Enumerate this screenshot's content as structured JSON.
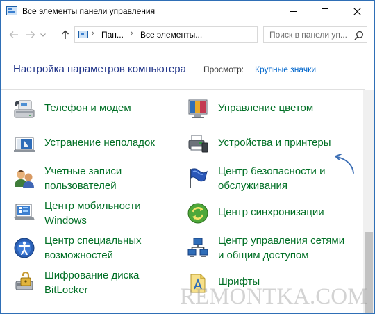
{
  "window": {
    "title": "Все элементы панели управления"
  },
  "addressbar": {
    "crumb_1": "Пан...",
    "crumb_2": "Все элементы...",
    "search_placeholder": "Поиск в панели уп..."
  },
  "header": {
    "title": "Настройка параметров компьютера",
    "view_label": "Просмотр:",
    "view_value": "Крупные значки"
  },
  "items": {
    "left": [
      {
        "line1": "Телефон и модем",
        "line2": "",
        "icon": "phone-modem-icon"
      },
      {
        "line1": "Устранение неполадок",
        "line2": "",
        "icon": "troubleshooting-icon"
      },
      {
        "line1": "Учетные записи",
        "line2": "пользователей",
        "icon": "user-accounts-icon"
      },
      {
        "line1": "Центр мобильности",
        "line2": "Windows",
        "icon": "mobility-center-icon"
      },
      {
        "line1": "Центр специальных",
        "line2": "возможностей",
        "icon": "ease-of-access-icon"
      },
      {
        "line1": "Шифрование диска",
        "line2": "BitLocker",
        "icon": "bitlocker-icon"
      }
    ],
    "right": [
      {
        "line1": "Управление цветом",
        "line2": "",
        "icon": "color-management-icon"
      },
      {
        "line1": "Устройства и принтеры",
        "line2": "",
        "icon": "devices-printers-icon"
      },
      {
        "line1": "Центр безопасности и",
        "line2": "обслуживания",
        "icon": "security-maintenance-icon"
      },
      {
        "line1": "Центр синхронизации",
        "line2": "",
        "icon": "sync-center-icon"
      },
      {
        "line1": "Центр управления сетями",
        "line2": "и общим доступом",
        "icon": "network-sharing-icon"
      },
      {
        "line1": "Шрифты",
        "line2": "",
        "icon": "fonts-icon"
      }
    ]
  },
  "watermark": "REMONTKA.COM",
  "colors": {
    "link_green": "#006f25",
    "title_blue": "#1e3287",
    "view_link": "#0066cc",
    "annotation_arrow": "#3d6fb5"
  }
}
